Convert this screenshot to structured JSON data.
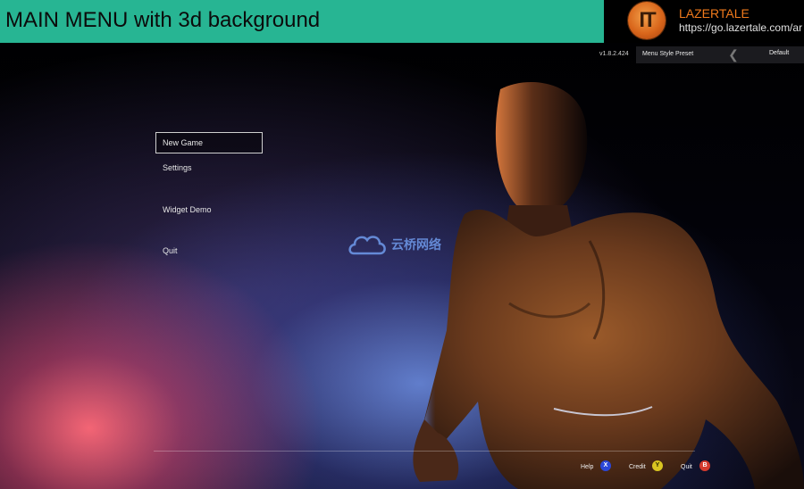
{
  "header": {
    "title": "MAIN MENU with 3d background",
    "brand_logo_text": "IT",
    "brand_name": "LAZERTALE",
    "brand_url": "https://go.lazertale.com/ar"
  },
  "top_right": {
    "version": "v1.8.2.424",
    "preset_label": "Menu Style Preset",
    "preset_value": "Default"
  },
  "menu": {
    "items": [
      {
        "label": "New Game",
        "selected": true
      },
      {
        "label": "Settings",
        "selected": false
      },
      {
        "label": "Widget Demo",
        "selected": false
      },
      {
        "label": "Quit",
        "selected": false
      }
    ]
  },
  "watermark": {
    "text": "云桥网络"
  },
  "bottom_hints": [
    {
      "label": "Help",
      "button": "X",
      "color": "#2b47d8"
    },
    {
      "label": "Credit",
      "button": "Y",
      "color": "#d9c521"
    },
    {
      "label": "Quit",
      "button": "B",
      "color": "#d53a2e"
    }
  ],
  "icons": {
    "preset_arrow": "chevron-left-icon",
    "watermark_logo": "cloud-icon"
  },
  "colors": {
    "banner": "#27b593",
    "brand": "#f07a1c",
    "selection_border": "#cfcfcf"
  }
}
